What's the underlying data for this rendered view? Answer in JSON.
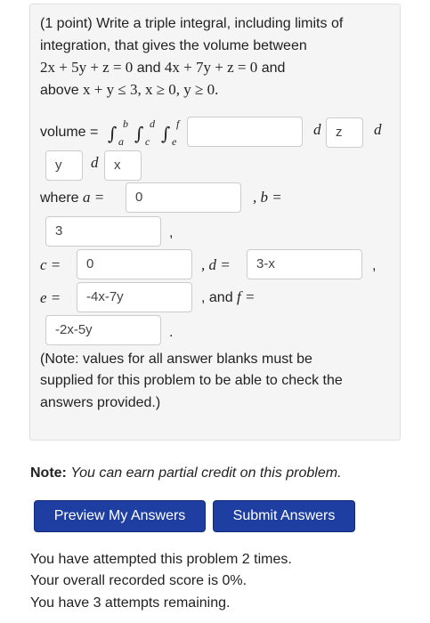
{
  "problem": {
    "intro_line1": "(1 point) Write a triple integral, including limits of",
    "intro_line2": "integration, that gives the volume between",
    "eq1": "2x + 5y + z = 0",
    "and1": "and",
    "eq2": "4x + 7y + z = 0",
    "and2": "and",
    "above_label": "above",
    "region": "x + y ≤ 3, x ≥ 0, y ≥ 0.",
    "volume_label": "volume =",
    "integral_symbol": "∫",
    "lim_b": "b",
    "lim_a": "a",
    "lim_d": "d",
    "lim_c": "c",
    "lim_f": "f",
    "lim_e": "e",
    "integrand_value": "",
    "d_symbol": "d",
    "var1_value": "z",
    "var2_value": "y",
    "var3_value": "x",
    "where_label": "where",
    "a_label": "a =",
    "a_value": "0",
    "b_label": ", b =",
    "b_value": "3",
    "c_label": "c =",
    "c_value": "0",
    "d_label": ", d =",
    "d_value": "3-x",
    "e_label": "e =",
    "e_value": "-4x-7y",
    "and_f_prefix": ", and",
    "f_label": "f =",
    "f_value": "-2x-5y",
    "comma": ",",
    "period": ".",
    "note_line1": "(Note: values for all answer blanks must be",
    "note_line2": "supplied for this problem to be able to check the",
    "note_line3": "answers provided.)"
  },
  "partial_note": {
    "bold": "Note:",
    "text": "You can earn partial credit on this problem."
  },
  "buttons": {
    "preview": "Preview My Answers",
    "submit": "Submit Answers"
  },
  "status": {
    "attempts": "You have attempted this problem 2 times.",
    "score": "Your overall recorded score is 0%.",
    "remaining": "You have 3 attempts remaining."
  }
}
